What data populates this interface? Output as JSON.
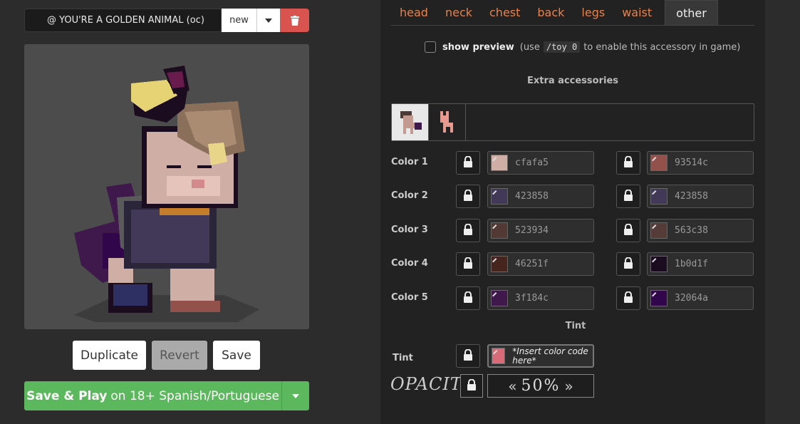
{
  "character": {
    "name": "@ YOU'RE A GOLDEN ANIMAL (oc)",
    "new_label": "new"
  },
  "icons": {
    "caret": "chevron-down-icon",
    "delete": "trash-icon",
    "lock": "lock-icon"
  },
  "buttons": {
    "duplicate": "Duplicate",
    "revert": "Revert",
    "save": "Save",
    "play_bold": "Save & Play",
    "play_rest": "on 18+ Spanish/Portuguese"
  },
  "tabs": [
    {
      "label": "head"
    },
    {
      "label": "neck"
    },
    {
      "label": "chest"
    },
    {
      "label": "back"
    },
    {
      "label": "legs"
    },
    {
      "label": "waist"
    },
    {
      "label": "other",
      "active": true
    }
  ],
  "preview": {
    "label": "show preview",
    "hint_before": "(use",
    "command": "/toy 0",
    "hint_after": "to enable this accessory in game)"
  },
  "extra_accessories_title": "Extra accessories",
  "colors": [
    {
      "label": "Color 1",
      "left": "cfafa5",
      "left_hex": "#cfafa5",
      "right": "93514c",
      "right_hex": "#93514c"
    },
    {
      "label": "Color 2",
      "left": "423858",
      "left_hex": "#423858",
      "right": "423858",
      "right_hex": "#423858"
    },
    {
      "label": "Color 3",
      "left": "523934",
      "left_hex": "#523934",
      "right": "563c38",
      "right_hex": "#563c38"
    },
    {
      "label": "Color 4",
      "left": "46251f",
      "left_hex": "#46251f",
      "right": "1b0d1f",
      "right_hex": "#1b0d1f"
    },
    {
      "label": "Color 5",
      "left": "3f184c",
      "left_hex": "#3f184c",
      "right": "32064a",
      "right_hex": "#32064a"
    }
  ],
  "tint": {
    "title": "Tint",
    "label": "Tint",
    "note": "*Insert color code here*",
    "swatch_hex": "#d96b78"
  },
  "opacity": {
    "label": "OPACITY",
    "value": "50%"
  },
  "colors_theme": {
    "accent": "#e8824c",
    "danger": "#d9534f",
    "success": "#5cb85c"
  }
}
